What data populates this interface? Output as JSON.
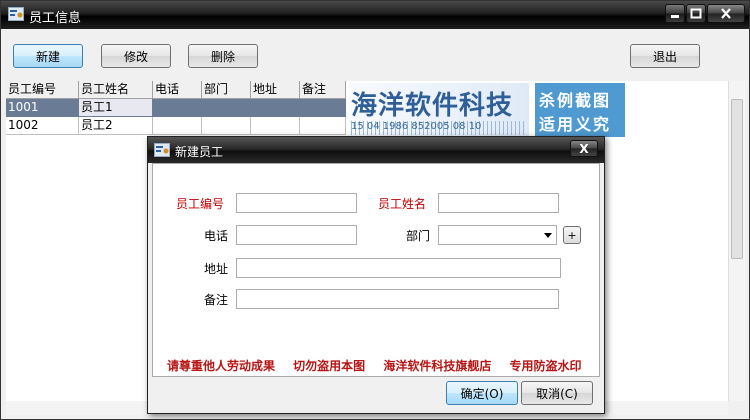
{
  "window": {
    "title": "员工信息"
  },
  "toolbar": {
    "new_label": "新建",
    "edit_label": "修改",
    "delete_label": "删除",
    "exit_label": "退出"
  },
  "grid": {
    "columns": [
      "员工编号",
      "员工姓名",
      "电话",
      "部门",
      "地址",
      "备注"
    ],
    "rows": [
      [
        "1001",
        "员工1",
        "",
        "",
        "",
        ""
      ],
      [
        "1002",
        "员工2",
        "",
        "",
        "",
        ""
      ]
    ]
  },
  "banner": {
    "title": "海洋软件科技",
    "numbers": "15  04  1986  852005  08  10",
    "right_line1": "杀例截图",
    "right_line2": "适用义究"
  },
  "dialog": {
    "title": "新建员工",
    "close_label": "X",
    "fields": {
      "emp_id_label": "员工编号",
      "emp_name_label": "员工姓名",
      "phone_label": "电话",
      "dept_label": "部门",
      "address_label": "地址",
      "remark_label": "备注",
      "plus_label": "+"
    },
    "watermark": "请尊重他人劳动成果 切勿盗用本图 海洋软件科技旗舰店 专用防盗水印",
    "ok_label": "确定(O)",
    "cancel_label": "取消(C)"
  }
}
